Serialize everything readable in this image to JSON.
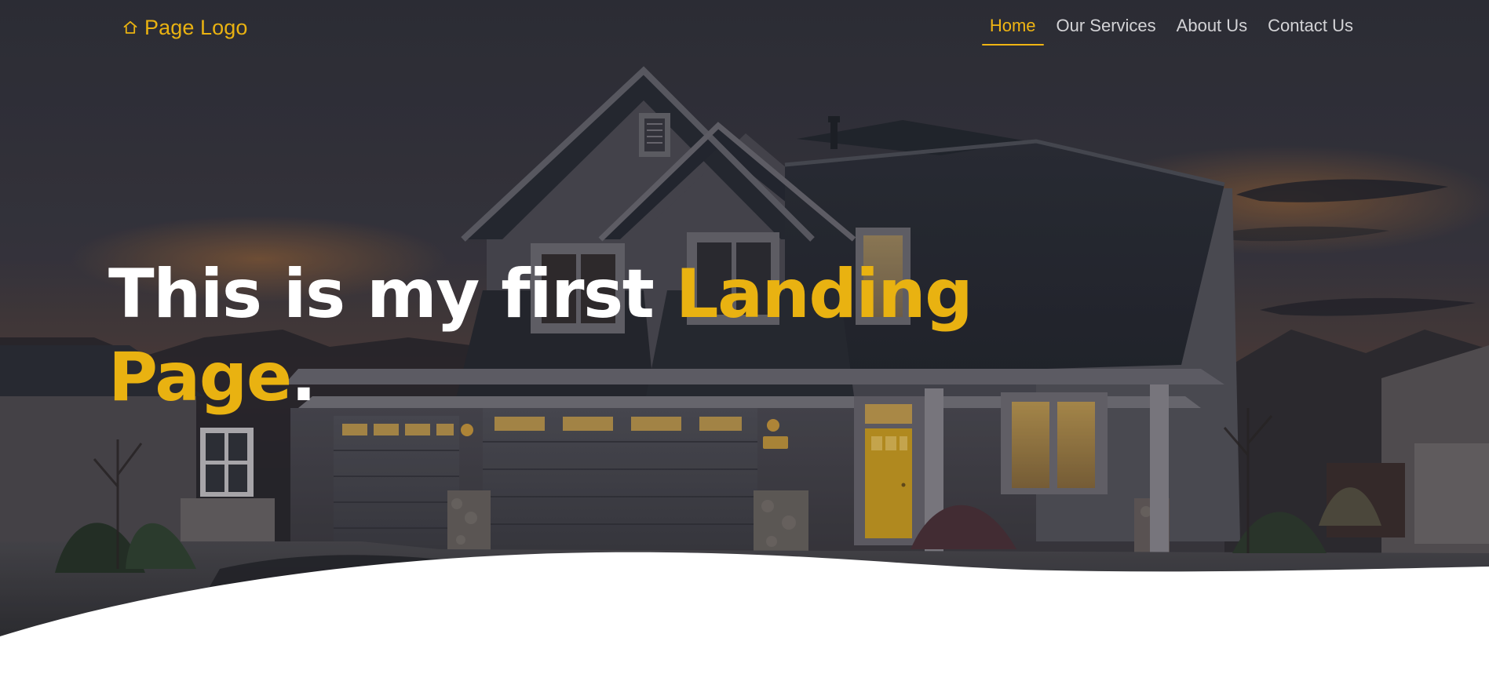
{
  "page": {
    "brand": {
      "logo_text": "Page Logo",
      "logo_icon": "home-outline-icon",
      "accent_color": "#e9b211"
    },
    "nav": {
      "items": [
        {
          "label": "Home",
          "active": true
        },
        {
          "label": "Our Services",
          "active": false
        },
        {
          "label": "About Us",
          "active": false
        },
        {
          "label": "Contact Us",
          "active": false
        }
      ],
      "active_color": "#f0b513",
      "inactive_color": "#d3d3d6"
    },
    "hero": {
      "headline_white": "This is my first",
      "headline_accent_1": "Landing",
      "headline_accent_2": "Page",
      "headline_punctuation": ".",
      "background_theme": "suburban house at dusk",
      "overlay_color": "#1c1c24"
    }
  }
}
